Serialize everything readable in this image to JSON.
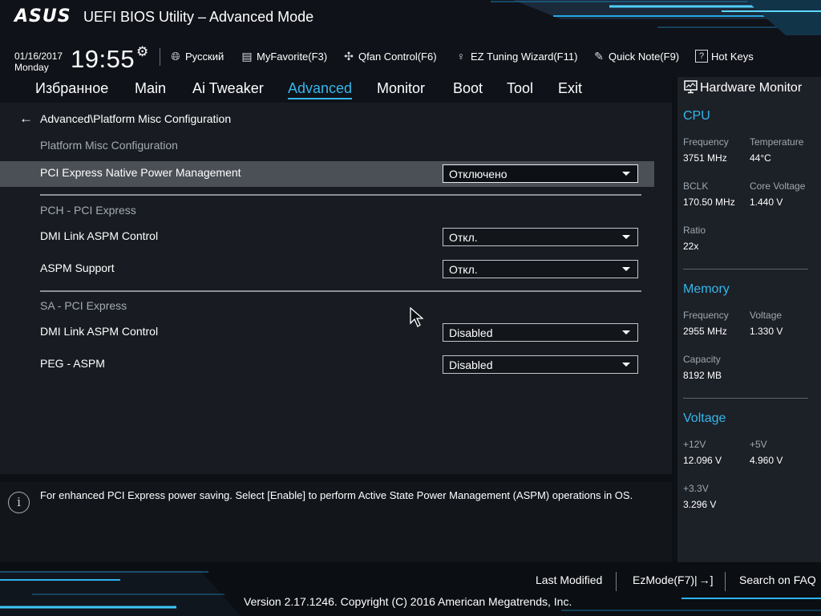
{
  "header": {
    "brand": "ASUS",
    "title": "UEFI BIOS Utility – Advanced Mode"
  },
  "clock": {
    "date": "01/16/2017",
    "day": "Monday",
    "time": "19:55"
  },
  "toolbar": {
    "language": "Русский",
    "myfavorite": "MyFavorite(F3)",
    "qfan": "Qfan Control(F6)",
    "ez_tuning": "EZ Tuning Wizard(F11)",
    "quick_note": "Quick Note(F9)",
    "hot_keys": "Hot Keys"
  },
  "tabs": [
    {
      "label": "Избранное",
      "active": false
    },
    {
      "label": "Main",
      "active": false
    },
    {
      "label": "Ai Tweaker",
      "active": false
    },
    {
      "label": "Advanced",
      "active": true
    },
    {
      "label": "Monitor",
      "active": false
    },
    {
      "label": "Boot",
      "active": false
    },
    {
      "label": "Tool",
      "active": false
    },
    {
      "label": "Exit",
      "active": false
    }
  ],
  "content": {
    "breadcrumb": "Advanced\\Platform Misc Configuration",
    "section_title": "Platform Misc Configuration",
    "pci_native_pm": {
      "label": "PCI Express Native Power Management",
      "value": "Отключено"
    },
    "pch_section": "PCH - PCI Express",
    "pch_dmi": {
      "label": "DMI Link ASPM Control",
      "value": "Откл."
    },
    "pch_aspm": {
      "label": "ASPM Support",
      "value": "Откл."
    },
    "sa_section": "SA - PCI Express",
    "sa_dmi": {
      "label": "DMI Link ASPM Control",
      "value": "Disabled"
    },
    "sa_peg": {
      "label": "PEG - ASPM",
      "value": "Disabled"
    }
  },
  "help": {
    "text": "For enhanced PCI Express power saving. Select [Enable] to perform Active State Power Management (ASPM) operations in OS."
  },
  "hardware_monitor": {
    "title": "Hardware Monitor",
    "cpu": {
      "heading": "CPU",
      "frequency_label": "Frequency",
      "frequency": "3751 MHz",
      "temperature_label": "Temperature",
      "temperature": "44°C",
      "bclk_label": "BCLK",
      "bclk": "170.50 MHz",
      "core_voltage_label": "Core Voltage",
      "core_voltage": "1.440 V",
      "ratio_label": "Ratio",
      "ratio": "22x"
    },
    "memory": {
      "heading": "Memory",
      "frequency_label": "Frequency",
      "frequency": "2955 MHz",
      "voltage_label": "Voltage",
      "voltage": "1.330 V",
      "capacity_label": "Capacity",
      "capacity": "8192 MB"
    },
    "voltage": {
      "heading": "Voltage",
      "v12_label": "+12V",
      "v12": "12.096 V",
      "v5_label": "+5V",
      "v5": "4.960 V",
      "v33_label": "+3.3V",
      "v33": "3.296 V"
    }
  },
  "footer": {
    "last_modified": "Last Modified",
    "ezmode": "EzMode(F7)|",
    "search_faq": "Search on FAQ",
    "copyright": "Version 2.17.1246. Copyright (C) 2016 American Megatrends, Inc."
  },
  "theme": {
    "accent": "#35b7ec",
    "selected_row": "#4b5056"
  }
}
